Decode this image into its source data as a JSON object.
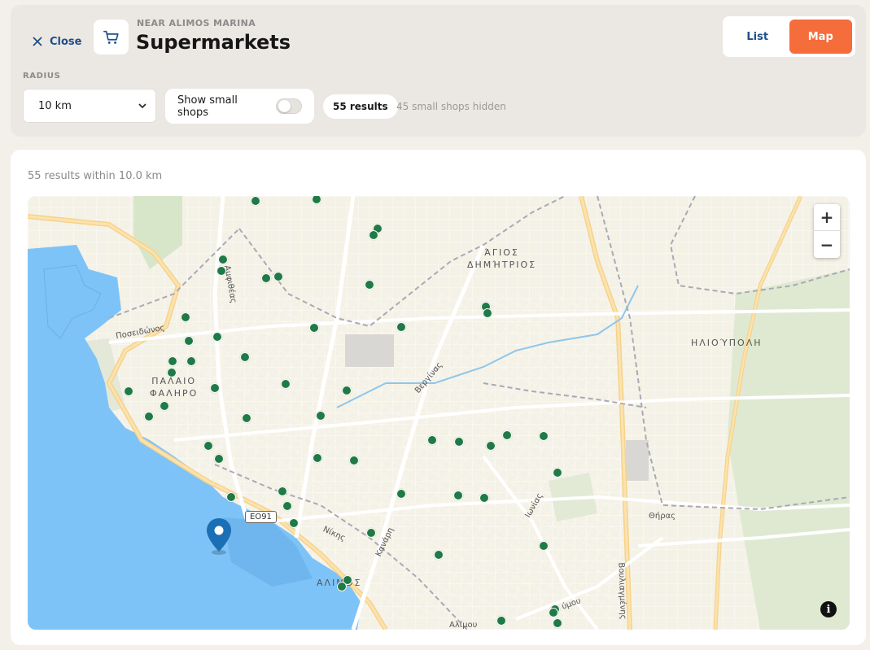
{
  "header": {
    "close_label": "Close",
    "subtitle": "NEAR ALIMOS MARINA",
    "title": "Supermarkets",
    "view_list_label": "List",
    "view_map_label": "Map",
    "active_view": "Map",
    "accent_color": "#f56d3b",
    "link_color": "#1e4f8a"
  },
  "filters": {
    "radius_label": "RADIUS",
    "radius_value": "10 km",
    "small_shops_label": "Show small shops",
    "small_shops_enabled": false,
    "results_badge": "55 results",
    "hidden_note": "45 small shops hidden"
  },
  "results": {
    "summary": "55 results within 10.0 km"
  },
  "map": {
    "area_labels": {
      "agios_1": "ΆΓΙΟΣ",
      "agios_2": "ΔΗΜΉΤΡΙΟΣ",
      "ilioupoli": "ΗΛΙΟΎΠΟΛΗ",
      "palaio_1": "ΠΑΛΑΙΟ",
      "palaio_2": "ΦΑΛΗΡΟ",
      "alimos": "ΑΛΙΜΟΣ"
    },
    "street_labels": {
      "poseidonos": "Ποσειδώνος",
      "vergina": "Βεργίνας",
      "ionias": "Ιωνίας",
      "thiras": "Θήρας",
      "nikis": "Νίκης",
      "kanari": "Κανάρη",
      "amfitheas": "Αμφιθέας",
      "vouliagmenis": "Βουλιαγμένης",
      "alimou": "Αλίμου",
      "ymou": "ύμου"
    },
    "road_shield": "ΕΟ91",
    "zoom_in": "+",
    "zoom_out": "−",
    "info": "i",
    "marker_color": "#1f7a45",
    "pin_color": "#1a6fb5",
    "store_count": 55
  }
}
